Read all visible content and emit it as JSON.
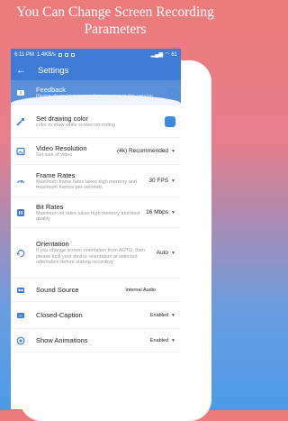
{
  "headline": [
    "You Can Change Screen Recording",
    "Parameters"
  ],
  "status_bar": {
    "time": "6:11 PM",
    "speed": "1.4KB/s",
    "battery": "61"
  },
  "app_bar": {
    "title": "Settings"
  },
  "settings": [
    {
      "key": "feedback",
      "title": "Feedback",
      "subtitle": "Please share your suggestion or errors in this version",
      "icon": "feedback-icon"
    },
    {
      "key": "drawing-color",
      "title": "Set drawing color",
      "subtitle": "color to draw while screen recording",
      "icon": "palette-icon"
    },
    {
      "key": "video-resolution",
      "title": "Video Resolution",
      "subtitle": "Set size of video",
      "value": "(4k) Recommended",
      "icon": "image-icon"
    },
    {
      "key": "frame-rates",
      "title": "Frame Rates",
      "subtitle": "Maximum frame rates takes high memory and maximum frames per seconds",
      "value": "30 FPS",
      "icon": "speedometer-icon"
    },
    {
      "key": "bit-rates",
      "title": "Bit Rates",
      "subtitle": "Maximum bit rates takes high memory and best quality",
      "value": "16 Mbps",
      "icon": "bitrate-icon"
    },
    {
      "key": "orientation",
      "title": "Orientation",
      "subtitle": "If you change screen orientation from AUTO, then please lock your device orientation at selected orientation before staring recording",
      "value": "Auto",
      "icon": "rotate-icon"
    },
    {
      "key": "sound-source",
      "title": "Sound Source",
      "value": "Internal Audio",
      "icon": "speaker-icon"
    },
    {
      "key": "closed-caption",
      "title": "Closed-Caption",
      "value": "Enabled",
      "icon": "cc-icon"
    },
    {
      "key": "show-animations",
      "title": "Show Animations",
      "value": "Enabled",
      "icon": "animation-icon"
    }
  ],
  "colors": {
    "accent": "#3d7bd6",
    "swatch": "#3d88e0"
  }
}
